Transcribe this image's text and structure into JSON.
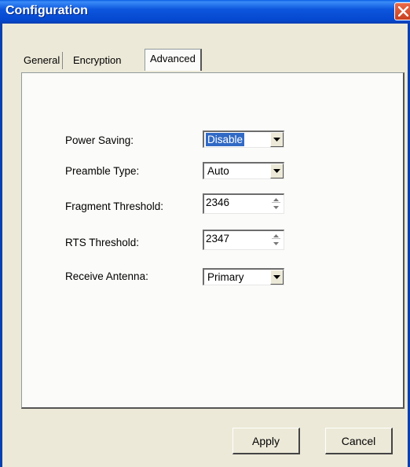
{
  "window": {
    "title": "Configuration"
  },
  "tabs": [
    {
      "label": "General",
      "active": false
    },
    {
      "label": "Encryption",
      "active": false
    },
    {
      "label": "Advanced",
      "active": true
    }
  ],
  "fields": {
    "power_saving": {
      "label": "Power Saving:",
      "value": "Disable",
      "type": "dropdown",
      "highlighted": true
    },
    "preamble_type": {
      "label": "Preamble Type:",
      "value": "Auto",
      "type": "dropdown"
    },
    "fragment_threshold": {
      "label": "Fragment Threshold:",
      "value": "2346",
      "type": "spinner"
    },
    "rts_threshold": {
      "label": "RTS Threshold:",
      "value": "2347",
      "type": "spinner"
    },
    "receive_antenna": {
      "label": "Receive Antenna:",
      "value": "Primary",
      "type": "dropdown"
    }
  },
  "buttons": {
    "apply": "Apply",
    "cancel": "Cancel"
  },
  "icons": {
    "close": "close-icon",
    "dropdown": "chevron-down-icon",
    "spin_up": "spin-up-icon",
    "spin_down": "spin-down-icon"
  },
  "colors": {
    "titlebar": "#0548d0",
    "close_button": "#c84020",
    "selection": "#316ac5",
    "face": "#ece9d8"
  }
}
